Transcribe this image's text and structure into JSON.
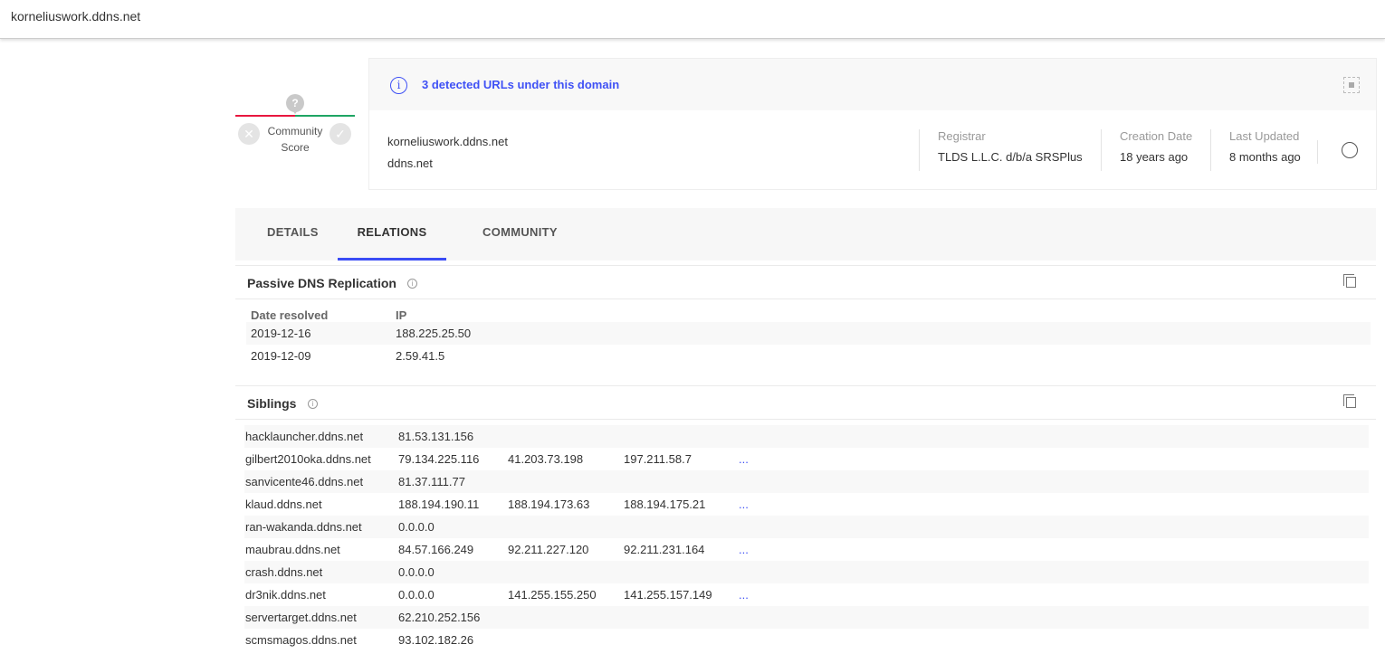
{
  "topbar": {
    "title": "korneliuswork.ddns.net"
  },
  "score": {
    "label_line1": "Community",
    "label_line2": "Score",
    "unknown": "?"
  },
  "card": {
    "detected": "3 detected URLs under this domain",
    "domain": "korneliuswork.ddns.net",
    "parent": "ddns.net",
    "meta": [
      {
        "label": "Registrar",
        "value": "TLDS L.L.C. d/b/a SRSPlus"
      },
      {
        "label": "Creation Date",
        "value": "18 years ago"
      },
      {
        "label": "Last Updated",
        "value": "8 months ago"
      }
    ]
  },
  "tabs": [
    {
      "label": "DETAILS"
    },
    {
      "label": "RELATIONS",
      "active": true
    },
    {
      "label": "COMMUNITY"
    }
  ],
  "dns": {
    "title": "Passive DNS Replication",
    "headers": [
      "Date resolved",
      "IP"
    ],
    "rows": [
      [
        "2019-12-16",
        "188.225.25.50"
      ],
      [
        "2019-12-09",
        "2.59.41.5"
      ]
    ]
  },
  "siblings": {
    "title": "Siblings",
    "rows": [
      [
        "hacklauncher.ddns.net",
        "81.53.131.156",
        "",
        "",
        ""
      ],
      [
        "gilbert2010oka.ddns.net",
        "79.134.225.116",
        "41.203.73.198",
        "197.211.58.7",
        "..."
      ],
      [
        "sanvicente46.ddns.net",
        "81.37.111.77",
        "",
        "",
        ""
      ],
      [
        "klaud.ddns.net",
        "188.194.190.11",
        "188.194.173.63",
        "188.194.175.21",
        "..."
      ],
      [
        "ran-wakanda.ddns.net",
        "0.0.0.0",
        "",
        "",
        ""
      ],
      [
        "maubrau.ddns.net",
        "84.57.166.249",
        "92.211.227.120",
        "92.211.231.164",
        "..."
      ],
      [
        "crash.ddns.net",
        "0.0.0.0",
        "",
        "",
        ""
      ],
      [
        "dr3nik.ddns.net",
        "0.0.0.0",
        "141.255.155.250",
        "141.255.157.149",
        "..."
      ],
      [
        "servertarget.ddns.net",
        "62.210.252.156",
        "",
        "",
        ""
      ],
      [
        "scmsmagos.ddns.net",
        "93.102.182.26",
        "",
        "",
        ""
      ]
    ]
  },
  "colors": {
    "accent": "#3b4cf5",
    "malicious": "#e8173f",
    "harmless": "#1fa564"
  }
}
